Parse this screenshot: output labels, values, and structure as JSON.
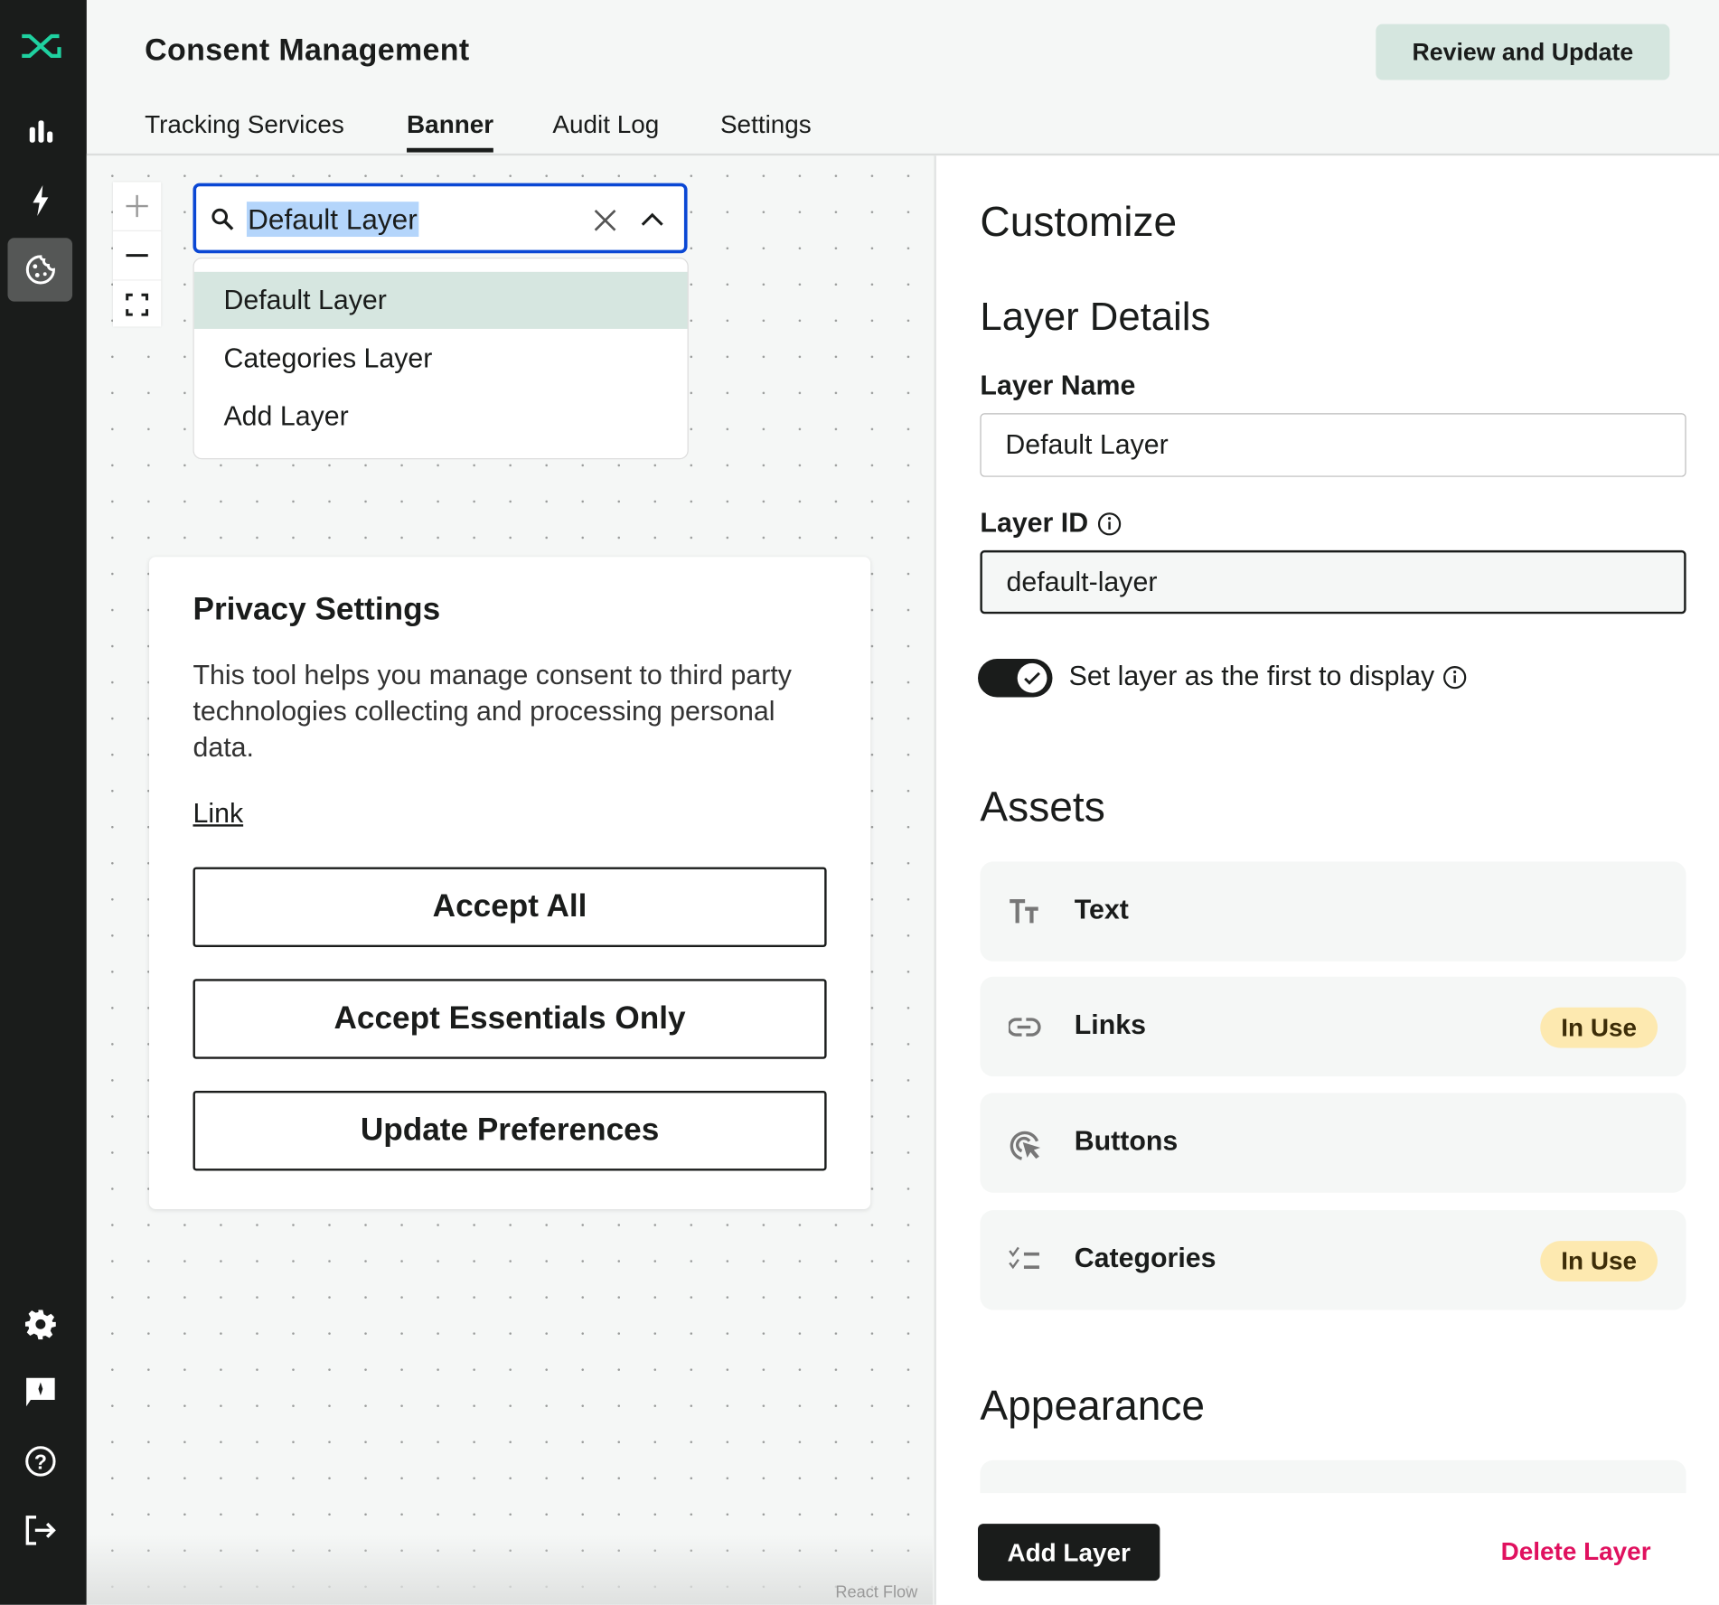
{
  "app": {
    "title": "Consent Management",
    "accent": "#1fd1a0"
  },
  "sidebar": {
    "items": [
      {
        "icon": "bar-chart-icon"
      },
      {
        "icon": "bolt-icon"
      },
      {
        "icon": "cookie-icon",
        "active": true
      },
      {
        "icon": "gear-icon"
      },
      {
        "icon": "feedback-icon"
      },
      {
        "icon": "help-icon"
      },
      {
        "icon": "logout-icon"
      }
    ]
  },
  "header": {
    "review_button": "Review and Update",
    "tabs": [
      {
        "label": "Tracking Services"
      },
      {
        "label": "Banner",
        "active": true
      },
      {
        "label": "Audit Log"
      },
      {
        "label": "Settings"
      }
    ]
  },
  "canvas": {
    "layer_search": {
      "value": "Default Layer"
    },
    "dropdown": {
      "options": [
        "Default Layer",
        "Categories Layer",
        "Add Layer"
      ],
      "selected": "Default Layer"
    },
    "attribution": "React Flow",
    "banner_preview": {
      "title": "Privacy Settings",
      "body": "This tool helps you manage consent to third party technologies collecting and processing personal data.",
      "link": "Link",
      "buttons": [
        "Accept All",
        "Accept Essentials Only",
        "Update Preferences"
      ]
    }
  },
  "panel": {
    "title": "Customize",
    "layer_details": "Layer Details",
    "layer_name_label": "Layer Name",
    "layer_name_value": "Default Layer",
    "layer_id_label": "Layer ID",
    "layer_id_value": "default-layer",
    "first_display_label": "Set layer as the first to display",
    "first_display_on": true,
    "assets_title": "Assets",
    "assets": [
      {
        "name": "Text",
        "icon": "text-size-icon",
        "badge": ""
      },
      {
        "name": "Links",
        "icon": "link-icon",
        "badge": "In Use"
      },
      {
        "name": "Buttons",
        "icon": "click-target-icon",
        "badge": ""
      },
      {
        "name": "Categories",
        "icon": "checklist-icon",
        "badge": "In Use"
      }
    ],
    "appearance_title": "Appearance",
    "add_layer": "Add Layer",
    "delete_layer": "Delete Layer",
    "delete_color": "#e0115f"
  }
}
